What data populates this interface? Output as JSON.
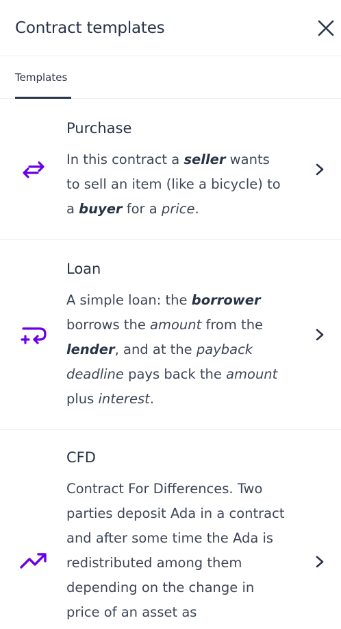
{
  "header": {
    "title": "Contract templates"
  },
  "tabs": [
    {
      "label": "Templates"
    }
  ],
  "colors": {
    "accent": "#6b00e6",
    "text": "#283346",
    "divider": "#eeeef2"
  },
  "templates": [
    {
      "title": "Purchase",
      "icon": "swap-arrows-icon",
      "desc": {
        "p1": "In this contract a ",
        "b1": "seller",
        "p2": " wants to sell an item (like a bicycle) to a ",
        "b2": "buyer",
        "p3": " for a ",
        "i1": "price",
        "p4": "."
      }
    },
    {
      "title": "Loan",
      "icon": "loan-return-icon",
      "desc": {
        "p1": "A simple loan: the ",
        "b1": "borrower",
        "p2": " borrows the ",
        "i1": "amount",
        "p3": " from the ",
        "b2": "lender",
        "p4": ", and at the ",
        "i2": "payback deadline",
        "p5": " pays back the ",
        "i3": "amount",
        "p6": " plus ",
        "i4": "interest",
        "p7": "."
      }
    },
    {
      "title": "CFD",
      "icon": "trending-up-icon",
      "desc": "Contract For Differences. Two parties deposit Ada in a contract and after some time the Ada is redistributed among them depending on the change in price of an asset as"
    }
  ]
}
